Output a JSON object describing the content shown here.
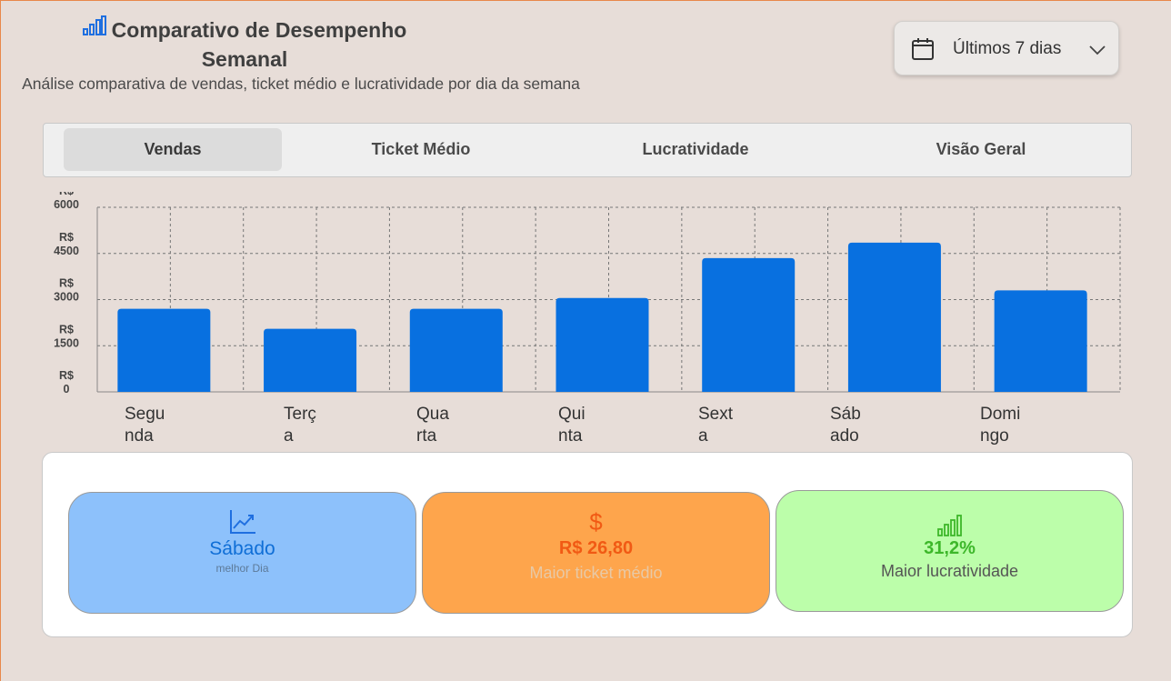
{
  "header": {
    "title": "Comparativo de Desempenho Semanal",
    "subtitle": "Análise comparativa de vendas, ticket médio e lucratividade por dia da semana",
    "title_icon": "bar-chart-icon"
  },
  "period_selector": {
    "label": "Últimos 7 dias",
    "icon": "calendar-icon",
    "chevron": "chevron-down-icon"
  },
  "tabs": [
    {
      "label": "Vendas",
      "active": true
    },
    {
      "label": "Ticket Médio",
      "active": false
    },
    {
      "label": "Lucratividade",
      "active": false
    },
    {
      "label": "Visão Geral",
      "active": false
    }
  ],
  "chart_data": {
    "type": "bar",
    "categories": [
      "Segunda",
      "Terça",
      "Quarta",
      "Quinta",
      "Sexta",
      "Sábado",
      "Domingo"
    ],
    "category_labels": [
      [
        "Segu",
        "nda"
      ],
      [
        "Terç",
        "a"
      ],
      [
        "Qua",
        "rta"
      ],
      [
        "Qui",
        "nta"
      ],
      [
        "Sext",
        "a"
      ],
      [
        "Sáb",
        "ado"
      ],
      [
        "Domi",
        "ngo"
      ]
    ],
    "values": [
      2700,
      2050,
      2700,
      3050,
      4350,
      4850,
      3300
    ],
    "ylim": [
      0,
      6000
    ],
    "yticks": [
      0,
      1500,
      3000,
      4500,
      6000
    ],
    "ytick_labels": [
      [
        "R$",
        "0"
      ],
      [
        "R$",
        "1500"
      ],
      [
        "R$",
        "3000"
      ],
      [
        "R$",
        "4500"
      ],
      [
        "R$",
        "6000"
      ]
    ],
    "grid": true,
    "bar_color": "#0870e0"
  },
  "summary_cards": [
    {
      "icon": "trending-up-icon",
      "value": "Sábado",
      "label": "melhor Dia",
      "color": "#8dc1fb"
    },
    {
      "icon": "dollar-icon",
      "icon_text": "$",
      "value": "R$ 26,80",
      "label": "Maior ticket médio",
      "color": "#fea54c"
    },
    {
      "icon": "bar-chart-icon",
      "value": "31,2%",
      "label": "Maior lucratividade",
      "color": "#bcfeaa"
    }
  ]
}
